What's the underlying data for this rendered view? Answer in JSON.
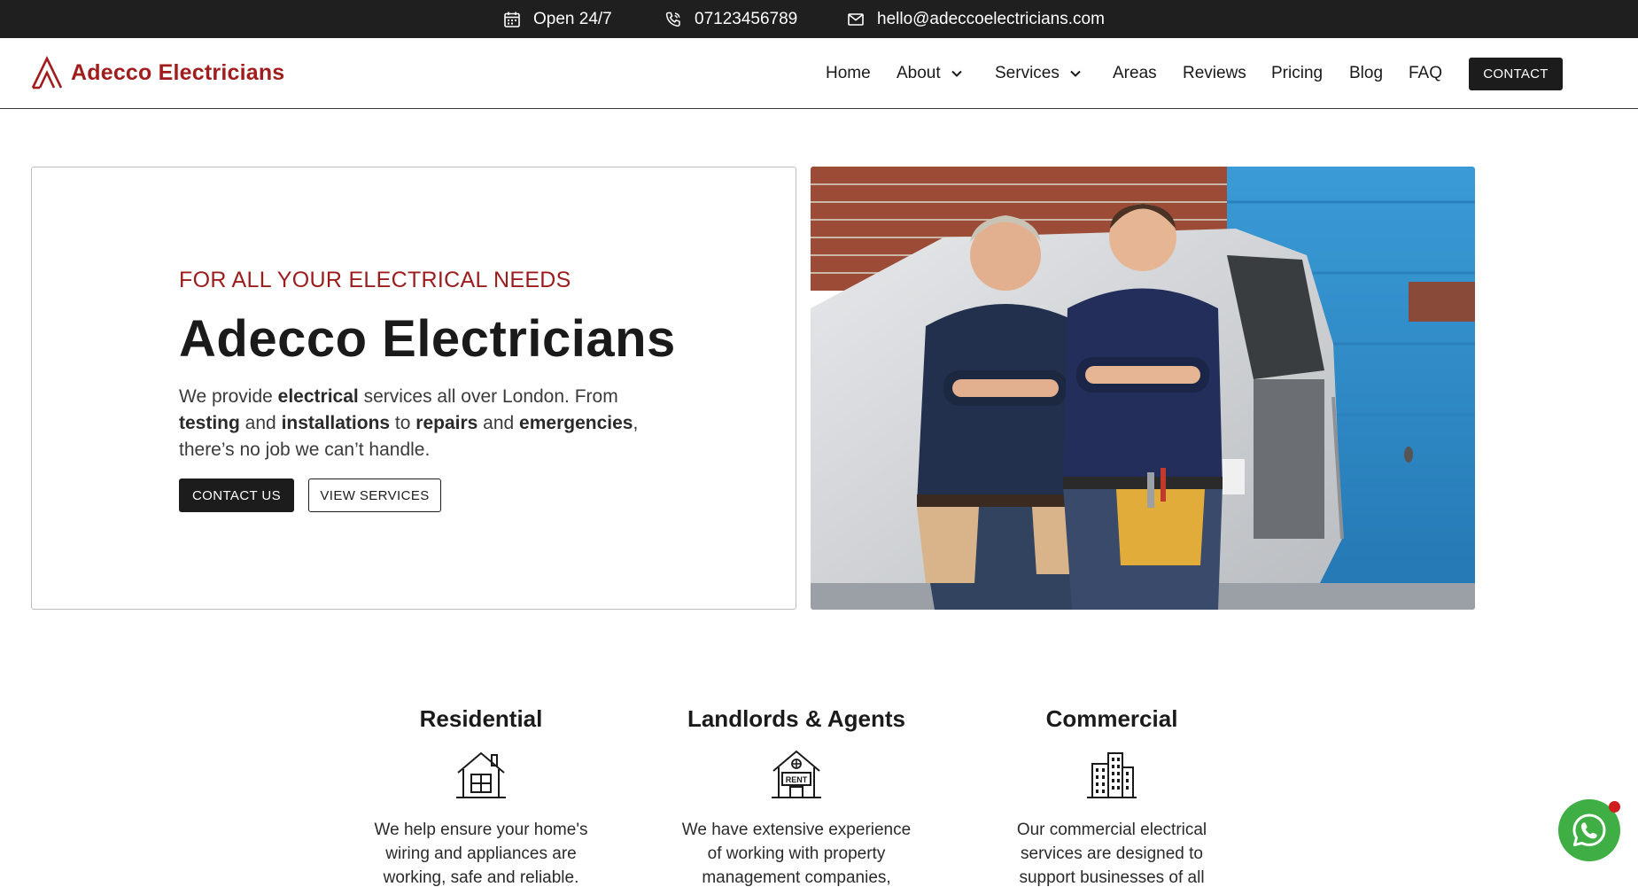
{
  "topbar": {
    "hours": "Open 24/7",
    "phone": "07123456789",
    "email": "hello@adeccoelectricians.com"
  },
  "brand": {
    "name": "Adecco Electricians",
    "color": "#a11d1d"
  },
  "nav": {
    "items": [
      {
        "label": "Home"
      },
      {
        "label": "About"
      },
      {
        "label": "Services"
      },
      {
        "label": "Areas"
      },
      {
        "label": "Reviews"
      },
      {
        "label": "Pricing"
      },
      {
        "label": "Blog"
      },
      {
        "label": "FAQ"
      }
    ],
    "contact_label": "CONTACT"
  },
  "hero": {
    "eyebrow": "FOR ALL YOUR ELECTRICAL NEEDS",
    "title": "Adecco Electricians",
    "desc": {
      "p1": "We provide ",
      "b1": "electrical",
      "p2": " services all over London. From ",
      "b2": "testing",
      "p3": " and ",
      "b3": "installations",
      "p4": " to ",
      "b4": "repairs",
      "p5": " and ",
      "b5": "emergencies",
      "p6": ", there’s no job we can’t handle."
    },
    "primary_button": "CONTACT US",
    "secondary_button": "VIEW SERVICES"
  },
  "services": [
    {
      "title": "Residential",
      "icon": "house-icon",
      "desc": "We help ensure your home's wiring and appliances are working, safe and reliable."
    },
    {
      "title": "Landlords & Agents",
      "icon": "rent-house-icon",
      "desc": "We have extensive experience of working with property management companies,"
    },
    {
      "title": "Commercial",
      "icon": "office-buildings-icon",
      "desc": "Our commercial electrical services are designed to support businesses of all sizes."
    }
  ],
  "whatsapp": {
    "icon": "whatsapp-icon",
    "color": "#3fae44"
  },
  "colors": {
    "topbar": "#1f1f1f",
    "accent": "#9b1c1c",
    "button": "#1c1c1c"
  }
}
